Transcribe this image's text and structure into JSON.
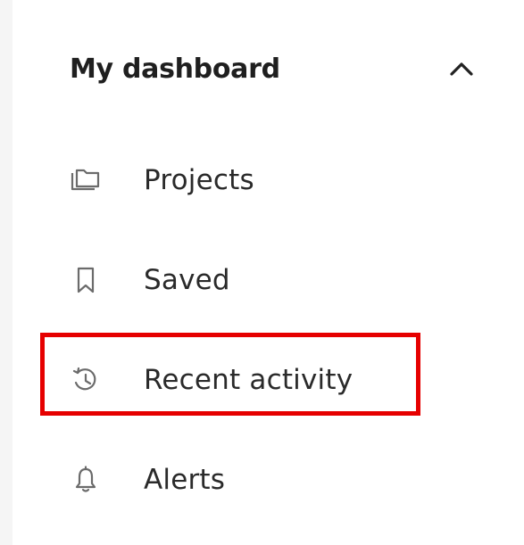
{
  "section": {
    "title": "My dashboard",
    "chevron_icon": "chevron-up-icon"
  },
  "nav_items": [
    {
      "label": "Projects",
      "icon": "folders-icon"
    },
    {
      "label": "Saved",
      "icon": "bookmark-icon"
    },
    {
      "label": "Recent activity",
      "icon": "history-icon"
    },
    {
      "label": "Alerts",
      "icon": "bell-icon"
    }
  ],
  "highlight": {
    "color": "#e60000",
    "target": "Recent activity"
  }
}
